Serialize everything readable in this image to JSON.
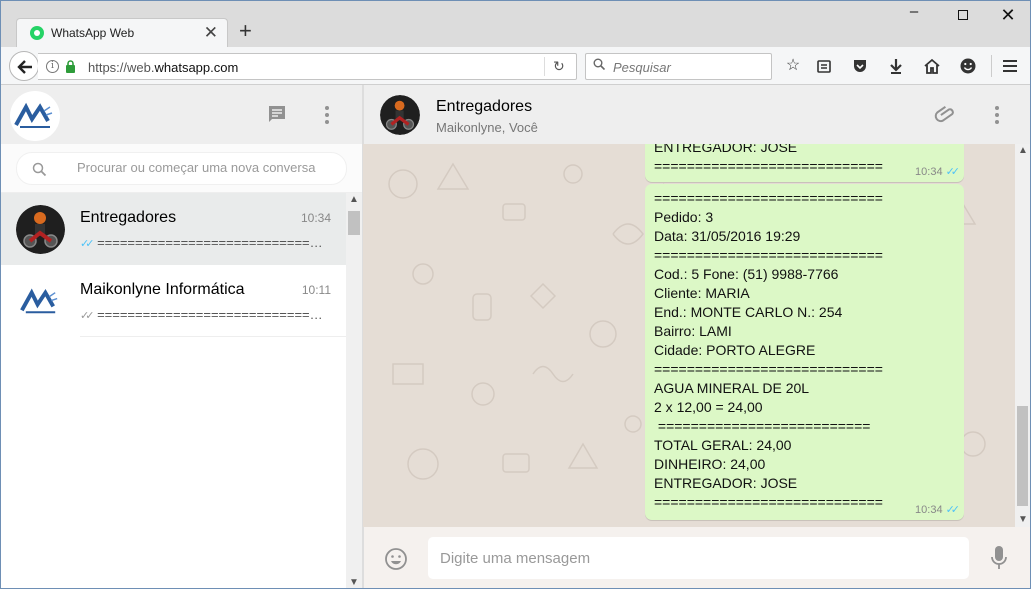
{
  "browser": {
    "tab_title": "WhatsApp Web",
    "tab_close": "✕",
    "new_tab": "+",
    "url_prefix": "https://web.",
    "url_host": "whatsapp.com",
    "search_placeholder": "Pesquisar"
  },
  "sidebar": {
    "search_placeholder": "Procurar ou começar uma nova conversa",
    "chats": [
      {
        "name": "Entregadores",
        "time": "10:34",
        "preview": "================================",
        "ticks": "✓✓"
      },
      {
        "name": "Maikonlyne Informática",
        "time": "10:11",
        "preview": "================================",
        "ticks": "✓✓"
      }
    ]
  },
  "conversation": {
    "title": "Entregadores",
    "members": "Maikonlyne, Você",
    "messages": [
      {
        "text": "ENTREGADOR: JOSE\n============================",
        "time": "10:34",
        "ticks": "✓✓"
      },
      {
        "text": "============================\nPedido: 3\nData: 31/05/2016 19:29\n============================\nCod.: 5 Fone: (51) 9988-7766\nCliente: MARIA\nEnd.: MONTE CARLO N.: 254\nBairro: LAMI\nCidade: PORTO ALEGRE\n============================\nAGUA MINERAL DE 20L\n2 x 12,00 = 24,00\n ==========================\nTOTAL GERAL: 24,00\nDINHEIRO: 24,00\nENTREGADOR: JOSE\n============================",
        "time": "10:34",
        "ticks": "✓✓"
      }
    ],
    "composer_placeholder": "Digite uma mensagem"
  },
  "colors": {
    "bubble_out": "#dcf8c6",
    "chat_background": "#e5ddd5",
    "header": "#eeeeee",
    "read_ticks": "#4fc3f7"
  }
}
